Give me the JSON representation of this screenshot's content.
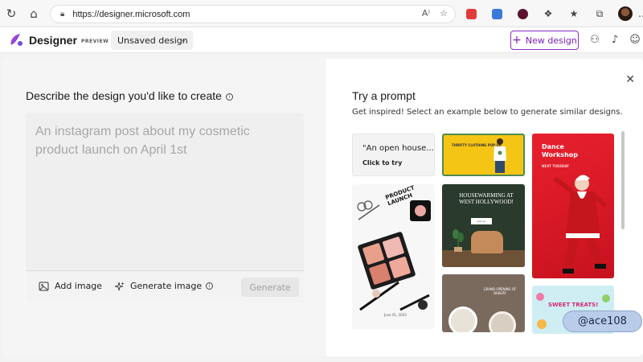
{
  "browser": {
    "url": "https://designer.microsoft.com"
  },
  "app": {
    "title": "Designer",
    "badge": "PREVIEW",
    "doc_name": "Unsaved design",
    "new_design_label": "New design"
  },
  "left": {
    "title": "Describe the design you'd like to create",
    "placeholder": "An instagram post about my cosmetic product launch on April 1st",
    "add_image_label": "Add image",
    "generate_image_label": "Generate image",
    "generate_label": "Generate"
  },
  "right": {
    "title": "Try a prompt",
    "subtitle": "Get inspired! Select an example below to generate similar designs.",
    "tiles": {
      "open_house_quote": "\"An open house...",
      "click_to_try": "Click to try",
      "thrift_label": "THRIFTY CLOTHING POP-UP",
      "dance_title": "Dance Workshop",
      "dance_sub": "NEXT TUESDAY",
      "product_title": "PRODUCT LAUNCH",
      "product_date": "June 01, 2023",
      "housewarming_title": "HOUSEWARMING AT WEST HOLLYWOOD!",
      "housewarming_btn": "Join us",
      "bakery_text": "GRAND OPENING OF BAKERY",
      "sweet_title": "SWEET TREATS!"
    }
  },
  "watermark": "@ace108",
  "colors": {
    "accent": "#7a1fb8",
    "dance_red": "#e8202e",
    "thrift_yellow": "#f4c515"
  }
}
